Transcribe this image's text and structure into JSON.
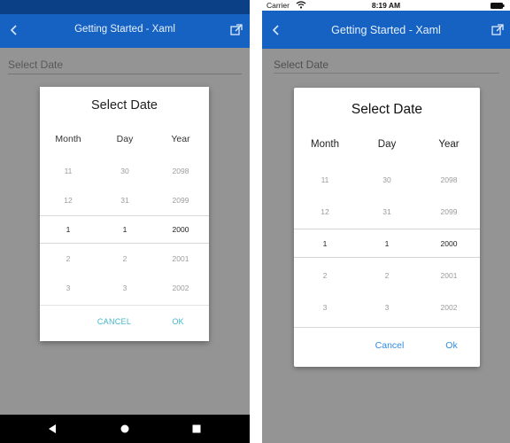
{
  "android": {
    "title": "Getting Started - Xaml",
    "field_placeholder": "Select Date",
    "dialog": {
      "title": "Select Date",
      "headers": [
        "Month",
        "Day",
        "Year"
      ],
      "months": [
        "11",
        "12",
        "1",
        "2",
        "3"
      ],
      "days": [
        "30",
        "31",
        "1",
        "2",
        "3"
      ],
      "years": [
        "2098",
        "2099",
        "2000",
        "2001",
        "2002"
      ],
      "cancel": "CANCEL",
      "ok": "OK"
    },
    "icons": {
      "back": "chevron-left-icon",
      "share": "open-external-icon",
      "nav_back": "triangle-back-icon",
      "nav_home": "circle-home-icon",
      "nav_recent": "square-recent-icon"
    },
    "colors": {
      "app_bar": "#1562c3",
      "status_bar": "#0b3f86",
      "accent": "#41b8c7"
    }
  },
  "ios": {
    "carrier": "Carrier",
    "time": "8:19 AM",
    "title": "Getting Started - Xaml",
    "field_placeholder": "Select Date",
    "dialog": {
      "title": "Select Date",
      "headers": [
        "Month",
        "Day",
        "Year"
      ],
      "months": [
        "11",
        "12",
        "1",
        "2",
        "3"
      ],
      "days": [
        "30",
        "31",
        "1",
        "2",
        "3"
      ],
      "years": [
        "2098",
        "2099",
        "2000",
        "2001",
        "2002"
      ],
      "cancel": "Cancel",
      "ok": "Ok"
    },
    "icons": {
      "wifi": "wifi-icon",
      "battery": "battery-icon",
      "back": "chevron-left-icon",
      "share": "open-external-icon"
    },
    "colors": {
      "nav_bar": "#1562c3",
      "accent": "#2e8be6"
    }
  }
}
